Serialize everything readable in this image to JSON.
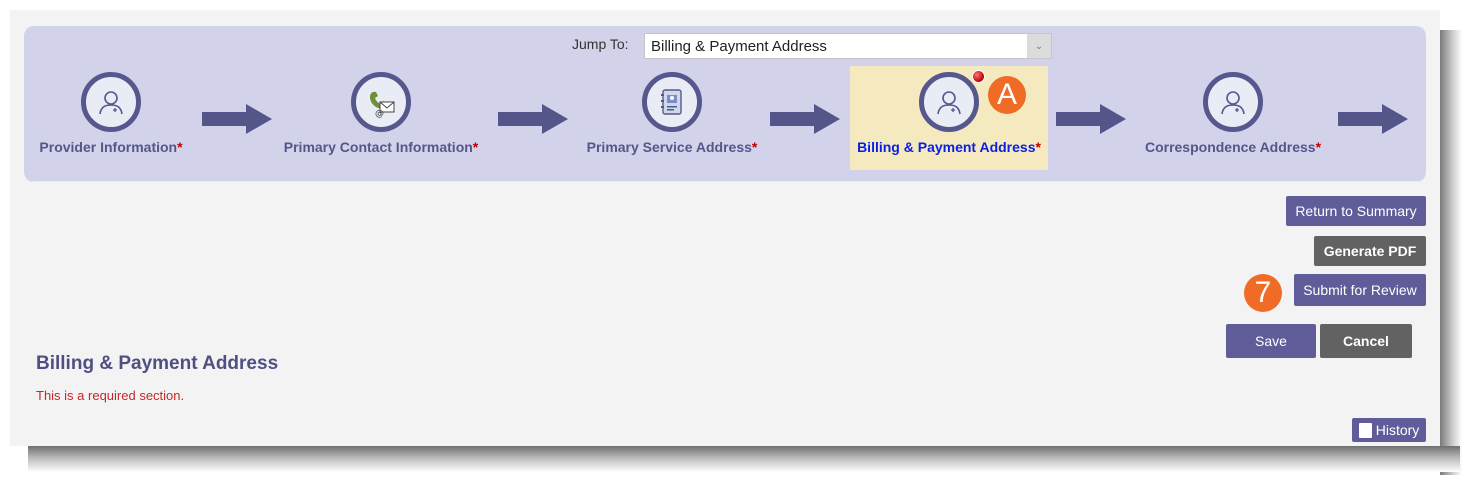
{
  "jump_to": {
    "label": "Jump To:",
    "selected": "Billing & Payment Address"
  },
  "wizard": {
    "steps": [
      {
        "label": "Provider Information",
        "required_mark": "*",
        "icon": "user-icon",
        "active": false
      },
      {
        "label": "Primary Contact Information",
        "required_mark": "*",
        "icon": "phone-mail-icon",
        "active": false
      },
      {
        "label": "Primary Service Address",
        "required_mark": "*",
        "icon": "address-book-icon",
        "active": false
      },
      {
        "label": "Billing & Payment Address",
        "required_mark": "*",
        "icon": "user-icon",
        "active": true
      },
      {
        "label": "Correspondence Address",
        "required_mark": "*",
        "icon": "user-icon",
        "active": false
      }
    ],
    "callout_a": "A"
  },
  "actions": {
    "return_to_summary": "Return to Summary",
    "generate_pdf": "Generate PDF",
    "submit_for_review": "Submit for Review",
    "callout_7": "7",
    "save": "Save",
    "cancel": "Cancel"
  },
  "section": {
    "title": "Billing & Payment Address",
    "note": "This is a required section."
  },
  "history": {
    "label": "History"
  },
  "colors": {
    "accent": "#5f5c99",
    "wizard_bg": "#d2d3ea",
    "active_step_bg": "#f4e9bf",
    "active_label": "#0a1ee6",
    "required": "#c00000",
    "callout": "#f06b25"
  }
}
